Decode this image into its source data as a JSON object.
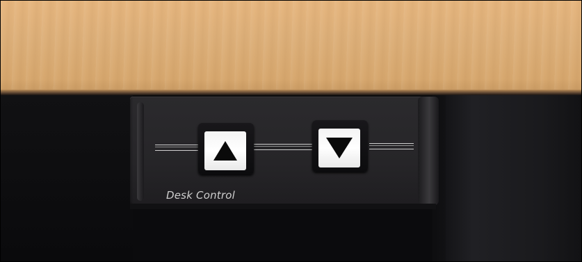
{
  "photo": {
    "panel_label": "Desk Control",
    "buttons": [
      {
        "id": "up",
        "icon": "up-triangle-icon"
      },
      {
        "id": "down",
        "icon": "down-triangle-icon"
      }
    ],
    "colors": {
      "desk_wood": "#ddb07a",
      "panel": "#262528",
      "button_face": "#ffffff",
      "arrow": "#0a0a0a",
      "label_text": "#cfcfcf"
    }
  }
}
